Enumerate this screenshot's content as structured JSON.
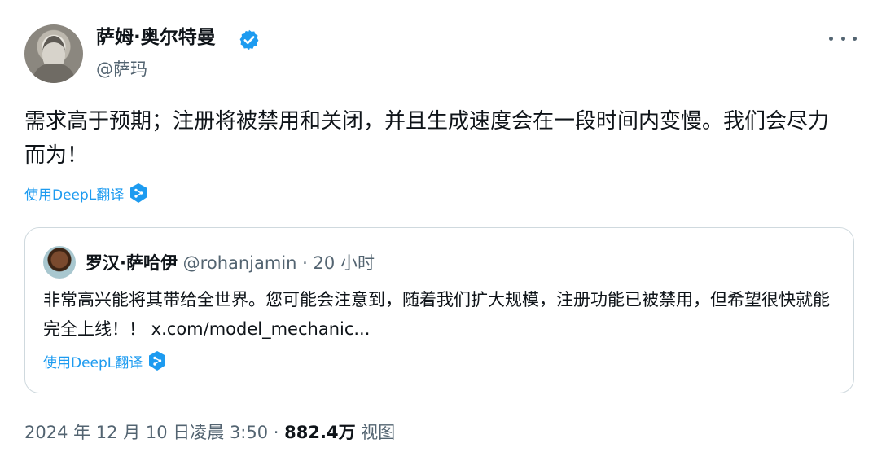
{
  "author": {
    "display_name": "萨姆·奥尔特曼",
    "handle": "@萨玛",
    "verified": true
  },
  "tweet": {
    "text": "需求高于预期；注册将被禁用和关闭，并且生成速度会在一段时间内变慢。我们会尽力而为！",
    "translate_label": "使用DeepL翻译"
  },
  "quoted_tweet": {
    "display_name": "罗汉·萨哈伊",
    "handle": "@rohanjamin",
    "separator": "·",
    "time": "20 小时",
    "text": "非常高兴能将其带给全世界。您可能会注意到，随着我们扩大规模，注册功能已被禁用，但希望很快就能完全上线！！ x.com/model_mechanic...",
    "translate_label": "使用DeepL翻译"
  },
  "footer": {
    "timestamp": "2024 年 12 月 10 日凌晨 3:50",
    "separator": "·",
    "views": "882.4万",
    "views_label": "视图"
  },
  "colors": {
    "accent": "#1d9bf0",
    "text_primary": "#0f1419",
    "text_secondary": "#536471",
    "border": "#cfd9de"
  },
  "icons": [
    "verified-badge-icon",
    "more-options-icon",
    "deepl-icon"
  ]
}
